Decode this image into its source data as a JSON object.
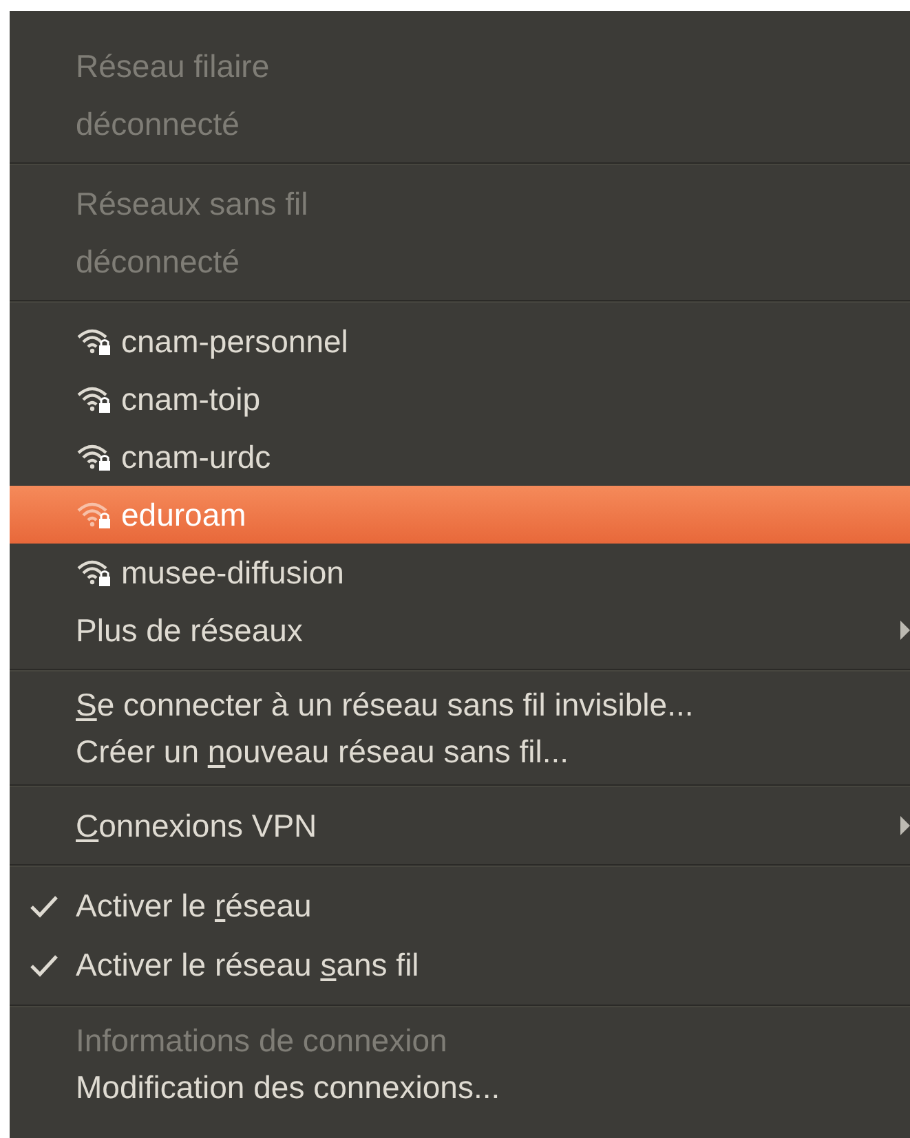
{
  "menu": {
    "sections": [
      {
        "items": [
          {
            "kind": "header",
            "label": "Réseau filaire",
            "disabled": true
          },
          {
            "kind": "header",
            "label": "déconnecté",
            "disabled": true
          }
        ]
      },
      {
        "items": [
          {
            "kind": "header",
            "label": "Réseaux sans fil",
            "disabled": true
          },
          {
            "kind": "header",
            "label": "déconnecté",
            "disabled": true
          }
        ]
      },
      {
        "items": [
          {
            "kind": "network",
            "label": "cnam-personnel",
            "selected": false
          },
          {
            "kind": "network",
            "label": "cnam-toip",
            "selected": false
          },
          {
            "kind": "network",
            "label": "cnam-urdc",
            "selected": false
          },
          {
            "kind": "network",
            "label": "eduroam",
            "selected": true
          },
          {
            "kind": "network",
            "label": "musee-diffusion",
            "selected": false
          },
          {
            "kind": "submenu",
            "label": "Plus de réseaux"
          }
        ]
      },
      {
        "items": [
          {
            "kind": "action",
            "mnemonic": "S",
            "after": "e connecter à un réseau sans fil invisible..."
          },
          {
            "kind": "action",
            "before": "Créer un ",
            "mnemonic": "n",
            "after": "ouveau réseau sans fil..."
          }
        ]
      },
      {
        "items": [
          {
            "kind": "submenu",
            "mnemonic": "C",
            "after": "onnexions VPN"
          }
        ]
      },
      {
        "items": [
          {
            "kind": "check",
            "before": "Activer le ",
            "mnemonic": "r",
            "after": "éseau",
            "checked": true
          },
          {
            "kind": "check",
            "before": "Activer le réseau ",
            "mnemonic": "s",
            "after": "ans fil",
            "checked": true
          }
        ]
      },
      {
        "items": [
          {
            "kind": "action",
            "label": "Informations de connexion",
            "disabled": true
          },
          {
            "kind": "action",
            "label": "Modification des connexions...",
            "disabled": false
          }
        ]
      }
    ]
  }
}
